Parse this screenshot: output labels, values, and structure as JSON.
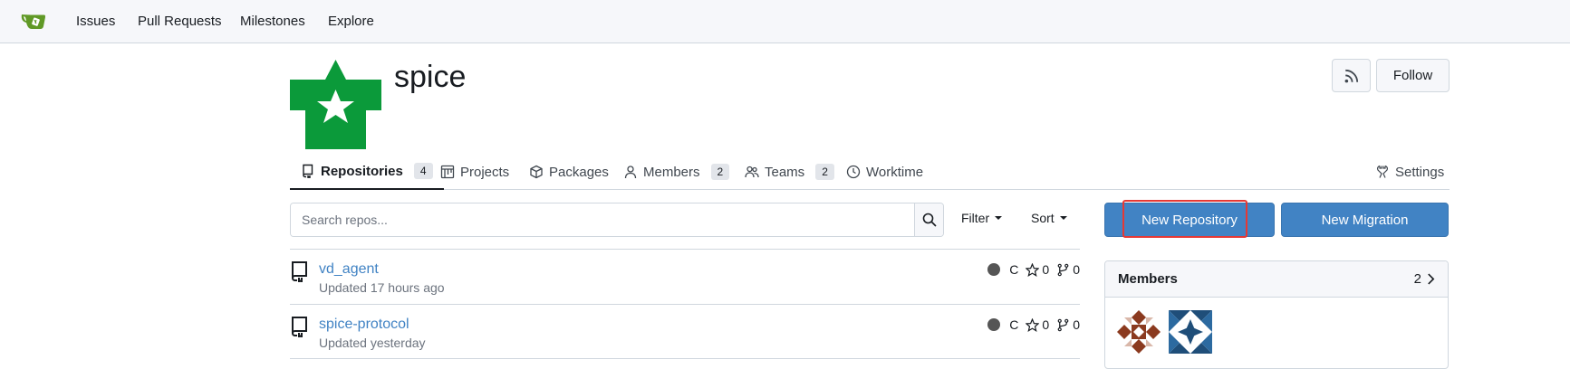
{
  "nav": {
    "links": [
      "Issues",
      "Pull Requests",
      "Milestones",
      "Explore"
    ]
  },
  "org": {
    "name": "spice",
    "follow_label": "Follow"
  },
  "tabs": [
    {
      "label": "Repositories",
      "count": "4",
      "icon": "repo-icon"
    },
    {
      "label": "Projects",
      "icon": "project-icon"
    },
    {
      "label": "Packages",
      "icon": "package-icon"
    },
    {
      "label": "Members",
      "count": "2",
      "icon": "person-icon"
    },
    {
      "label": "Teams",
      "count": "2",
      "icon": "people-icon"
    },
    {
      "label": "Worktime",
      "icon": "clock-icon"
    },
    {
      "label": "Settings",
      "icon": "tools-icon"
    }
  ],
  "search": {
    "placeholder": "Search repos..."
  },
  "filter_label": "Filter",
  "sort_label": "Sort",
  "actions": {
    "new_repository": "New Repository",
    "new_migration": "New Migration"
  },
  "repos": [
    {
      "name": "vd_agent",
      "updated": "Updated 17 hours ago",
      "language": "C",
      "stars": "0",
      "forks": "0"
    },
    {
      "name": "spice-protocol",
      "updated": "Updated yesterday",
      "language": "C",
      "stars": "0",
      "forks": "0"
    }
  ],
  "members_panel": {
    "title": "Members",
    "count": "2"
  },
  "colors": {
    "accent": "#4183c4",
    "brand_green": "#609926",
    "org_avatar_green": "#0b9a3a",
    "highlight": "#e53935"
  }
}
